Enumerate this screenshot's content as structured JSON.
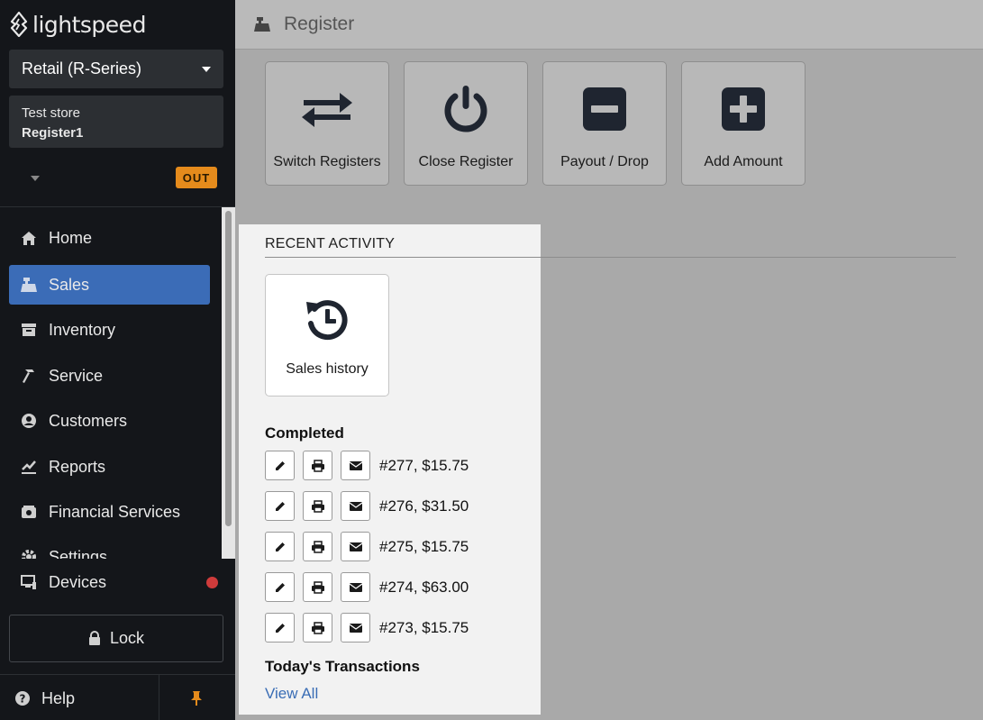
{
  "brand": {
    "name": "lightspeed"
  },
  "sidebar": {
    "retail_select": "Retail (R-Series)",
    "store": "Test store",
    "register": "Register1",
    "status_badge": "OUT",
    "items": [
      {
        "label": "Home",
        "icon": "home-icon"
      },
      {
        "label": "Sales",
        "icon": "cash-register-icon",
        "active": true
      },
      {
        "label": "Inventory",
        "icon": "inventory-icon"
      },
      {
        "label": "Service",
        "icon": "hammer-icon"
      },
      {
        "label": "Customers",
        "icon": "user-circle-icon"
      },
      {
        "label": "Reports",
        "icon": "chart-line-icon"
      },
      {
        "label": "Financial Services",
        "icon": "bank-icon"
      },
      {
        "label": "Settings",
        "icon": "gear-icon"
      }
    ],
    "devices": "Devices",
    "lock": "Lock",
    "help": "Help",
    "colors": {
      "active": "#3b6cb7",
      "badge": "#e58b1c",
      "alert_dot": "#cf3b3b"
    }
  },
  "header": {
    "title": "Register"
  },
  "actions": [
    {
      "label": "Switch Registers",
      "icon": "switch-arrows-icon"
    },
    {
      "label": "Close Register",
      "icon": "power-icon"
    },
    {
      "label": "Payout / Drop",
      "icon": "minus-square-icon"
    },
    {
      "label": "Add Amount",
      "icon": "plus-square-icon"
    }
  ],
  "recent": {
    "title": "RECENT ACTIVITY",
    "sales_history": "Sales history",
    "completed_title": "Completed",
    "transactions": [
      "#277, $15.75",
      "#276, $31.50",
      "#275, $15.75",
      "#274, $63.00",
      "#273, $15.75"
    ],
    "today_title": "Today's Transactions",
    "view_all": "View All"
  }
}
